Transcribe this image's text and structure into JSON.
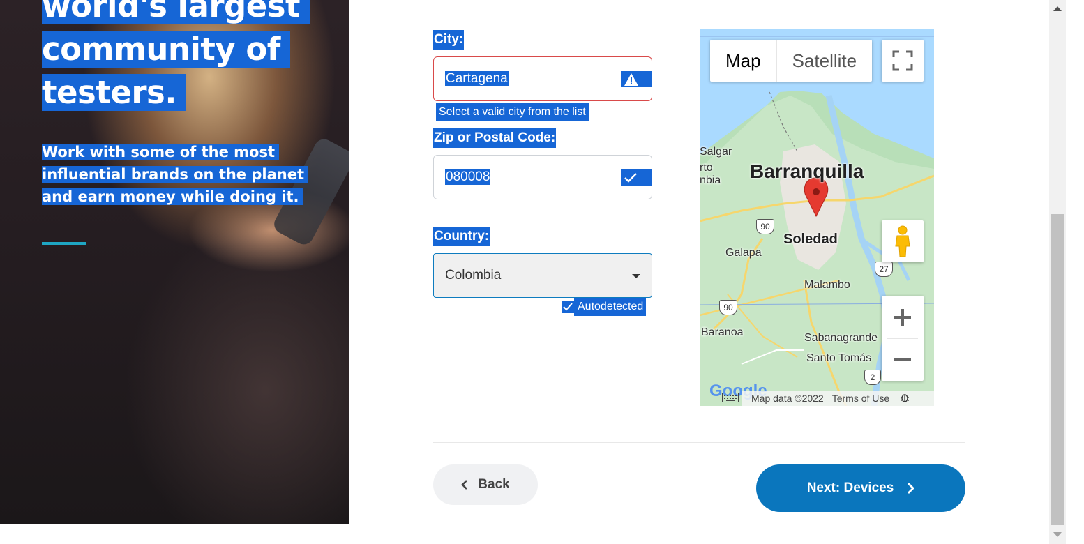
{
  "hero": {
    "heading_lines": [
      "world's largest",
      "community of",
      "testers."
    ],
    "subtitle": "Work with some of the most influential brands on the planet and earn money while doing it."
  },
  "form": {
    "city": {
      "label": "City:",
      "value": "Cartagena",
      "status_icon": "warning-icon",
      "error": "Select a valid city from the list"
    },
    "zip": {
      "label": "Zip or Postal Code:",
      "value": "080008",
      "status_icon": "checkmark-icon"
    },
    "country": {
      "label": "Country:",
      "value": "Colombia",
      "autodetect_label": "Autodetected"
    }
  },
  "map": {
    "type_options": [
      "Map",
      "Satellite"
    ],
    "selected_type": "Map",
    "places": {
      "barranquilla": "Barranquilla",
      "soledad": "Soledad",
      "galapa": "Galapa",
      "malambo": "Malambo",
      "baranoa": "Baranoa",
      "sabanagrande": "Sabanagrande",
      "santo_tomas": "Santo Tomás",
      "salgar": "Salgar",
      "puerto": "rto",
      "colombia": "nbia"
    },
    "route_shields": [
      "90",
      "27",
      "90",
      "2"
    ],
    "footer": {
      "map_data": "Map data ©2022",
      "terms": "Terms of Use"
    },
    "logo": "Google"
  },
  "nav": {
    "back_label": "Back",
    "next_label": "Next: Devices"
  },
  "colors": {
    "highlight": "#1666d6",
    "primary": "#0a76bd",
    "error_border": "#d94a4a",
    "accent": "#1fa6c3"
  }
}
